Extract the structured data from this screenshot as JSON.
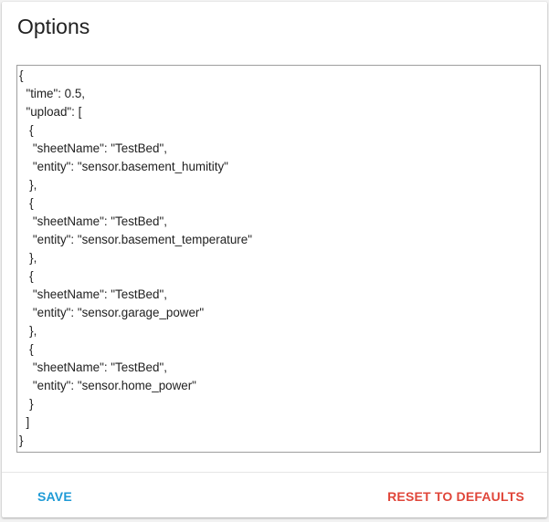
{
  "title": "Options",
  "options_json": "{\n  \"time\": 0.5,\n  \"upload\": [\n   {\n    \"sheetName\": \"TestBed\",\n    \"entity\": \"sensor.basement_humitity\"\n   },\n   {\n    \"sheetName\": \"TestBed\",\n    \"entity\": \"sensor.basement_temperature\"\n   },\n   {\n    \"sheetName\": \"TestBed\",\n    \"entity\": \"sensor.garage_power\"\n   },\n   {\n    \"sheetName\": \"TestBed\",\n    \"entity\": \"sensor.home_power\"\n   }\n  ]\n}",
  "actions": {
    "save_label": "SAVE",
    "reset_label": "RESET TO DEFAULTS"
  },
  "colors": {
    "save": "#1e9ad6",
    "reset": "#e0463a"
  }
}
